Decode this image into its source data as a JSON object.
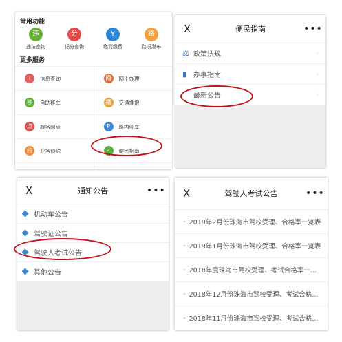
{
  "panel1": {
    "quick_title": "常用功能",
    "quick": [
      {
        "label": "违法查询",
        "icon": "violation-query-icon",
        "glyph": "违",
        "color": "#65b230"
      },
      {
        "label": "记分查询",
        "icon": "points-query-icon",
        "glyph": "分",
        "color": "#e84a4a"
      },
      {
        "label": "缴罚缴费",
        "icon": "payment-icon",
        "glyph": "¥",
        "color": "#2f86d6"
      },
      {
        "label": "路况发布",
        "icon": "road-report-icon",
        "glyph": "路",
        "color": "#f2a23a"
      }
    ],
    "more_title": "更多服务",
    "grid": [
      [
        {
          "label": "信息查询",
          "icon": "info-query-icon",
          "glyph": "i",
          "color": "#e25f5f"
        },
        {
          "label": "网上办理",
          "icon": "online-service-icon",
          "glyph": "网",
          "color": "#e0733a"
        }
      ],
      [
        {
          "label": "自助移车",
          "icon": "self-move-car-icon",
          "glyph": "移",
          "color": "#5db137"
        },
        {
          "label": "交通播报",
          "icon": "traffic-broadcast-icon",
          "glyph": "播",
          "color": "#e8a23a"
        }
      ],
      [
        {
          "label": "服务网点",
          "icon": "service-outlet-icon",
          "glyph": "点",
          "color": "#e25050"
        },
        {
          "label": "路内停车",
          "icon": "street-parking-icon",
          "glyph": "P",
          "color": "#3d8bd9"
        }
      ],
      [
        {
          "label": "业务预约",
          "icon": "appointment-icon",
          "glyph": "约",
          "color": "#ef8b3a"
        },
        {
          "label": "便民指南",
          "icon": "guide-icon",
          "glyph": "✓",
          "color": "#5aaa3a"
        }
      ],
      [
        {
          "label": "",
          "icon": "partial-icon-1",
          "glyph": "",
          "color": "#3d8bd9"
        },
        {
          "label": "",
          "icon": "partial-icon-2",
          "glyph": "",
          "color": "#3d8bd9"
        }
      ]
    ]
  },
  "panel2": {
    "close": "X",
    "title": "便民指南",
    "more": "•••",
    "items": [
      {
        "label": "政策法规",
        "glyph": "⚖"
      },
      {
        "label": "办事指南",
        "glyph": "▮"
      },
      {
        "label": "最新公告",
        "glyph": ""
      }
    ]
  },
  "panel3": {
    "close": "X",
    "title": "通知公告",
    "more": "•••",
    "items": [
      {
        "label": "机动车公告"
      },
      {
        "label": "驾驶证公告"
      },
      {
        "label": "驾驶人考试公告"
      },
      {
        "label": "其他公告"
      }
    ]
  },
  "panel4": {
    "close": "X",
    "title": "驾驶人考试公告",
    "more": "•••",
    "bullet": "-",
    "items": [
      {
        "label": "2019年2月份珠海市驾校受理、合格率一览表"
      },
      {
        "label": "2019年1月份珠海市驾校受理、合格率一览表"
      },
      {
        "label": "2018年度珠海市驾校受理、考试合格率一..."
      },
      {
        "label": "2018年12月份珠海市驾校受理、考试合格..."
      },
      {
        "label": "2018年11月份珠海市驾校受理、考试合格..."
      }
    ]
  },
  "highlight_color": "#c0121a"
}
